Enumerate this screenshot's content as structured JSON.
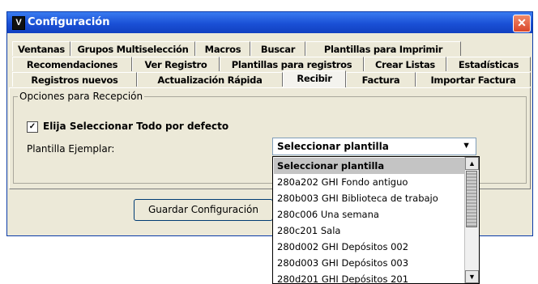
{
  "window": {
    "title": "Configuración",
    "app_icon": "V",
    "close_glyph": "✕"
  },
  "tabs": {
    "row1": [
      "Ventanas",
      "Grupos Multiselección",
      "Macros",
      "Buscar",
      "Plantillas para Imprimir"
    ],
    "row2": [
      "Recomendaciones",
      "Ver Registro",
      "Plantillas para registros",
      "Crear Listas",
      "Estadísticas"
    ],
    "row3": [
      "Registros nuevos",
      "Actualización Rápida",
      "Recibir",
      "Factura",
      "Importar Factura"
    ],
    "active": "Recibir"
  },
  "panel": {
    "group_title": "Opciones para Recepción",
    "checkbox_label": "Elija Seleccionar Todo por defecto",
    "checkbox_checked": true,
    "plantilla_label": "Plantilla Ejemplar:",
    "select_value": "Seleccionar plantilla"
  },
  "dropdown": {
    "options": [
      "Seleccionar plantilla",
      "280a202 GHI Fondo antiguo",
      "280b003 GHI Biblioteca de trabajo",
      "280c006 Una semana",
      "280c201 Sala",
      "280d002 GHI Depósitos 002",
      "280d003 GHI Depósitos 003",
      "280d201 GHI Depósitos 201"
    ],
    "selected": "Seleccionar plantilla"
  },
  "buttons": {
    "save": "Guardar Configuración"
  },
  "icons": {
    "checkbox": "checkmark-icon",
    "select": "chevron-down-icon",
    "close": "close-icon"
  },
  "colors": {
    "titlebar": "#1a50d6",
    "close": "#d9462a",
    "face": "#ece9d8"
  }
}
